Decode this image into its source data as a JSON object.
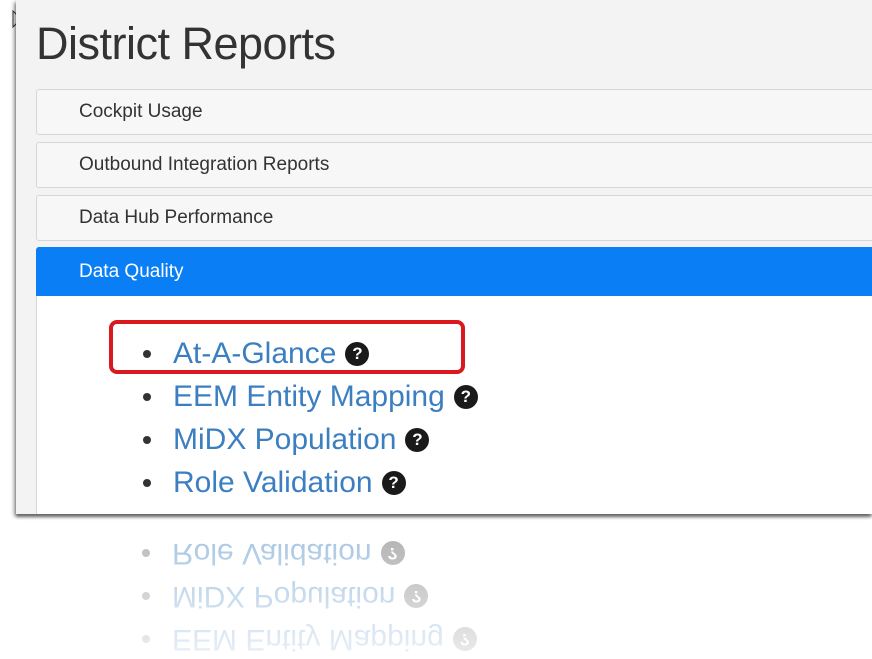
{
  "page": {
    "title": "District Reports"
  },
  "accordion": {
    "sections": [
      {
        "label": "Cockpit Usage",
        "active": false
      },
      {
        "label": "Outbound Integration Reports",
        "active": false
      },
      {
        "label": "Data Hub Performance",
        "active": false
      },
      {
        "label": "Data Quality",
        "active": true
      }
    ]
  },
  "data_quality": {
    "links": [
      {
        "label": "At-A-Glance",
        "help_icon": "question-circle-icon",
        "highlighted": true
      },
      {
        "label": "EEM Entity Mapping",
        "help_icon": "question-circle-icon"
      },
      {
        "label": "MiDX Population",
        "help_icon": "question-circle-icon"
      },
      {
        "label": "Role Validation",
        "help_icon": "question-circle-icon"
      }
    ],
    "help_glyph": "?"
  },
  "colors": {
    "accent": "#0a7ff5",
    "link": "#3b7fc1",
    "highlight": "#d9191d"
  }
}
